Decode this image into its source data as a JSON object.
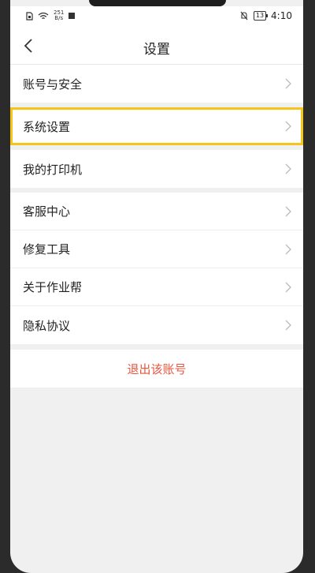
{
  "status_bar": {
    "net_speed_value": "251",
    "net_speed_unit": "B/s",
    "battery": "13",
    "time": "4:10"
  },
  "header": {
    "title": "设置",
    "back_icon": "chevron-left-icon"
  },
  "groups": [
    {
      "items": [
        {
          "label": "账号与安全"
        }
      ]
    },
    {
      "items": [
        {
          "label": "系统设置",
          "highlighted": true
        }
      ]
    },
    {
      "items": [
        {
          "label": "我的打印机"
        }
      ]
    },
    {
      "items": [
        {
          "label": "客服中心"
        },
        {
          "label": "修复工具"
        },
        {
          "label": "关于作业帮"
        },
        {
          "label": "隐私协议"
        }
      ]
    }
  ],
  "logout": {
    "label": "退出该账号"
  },
  "colors": {
    "accent_red": "#e8553f",
    "highlight_yellow": "#f5c518",
    "background": "#f0f0f0"
  }
}
